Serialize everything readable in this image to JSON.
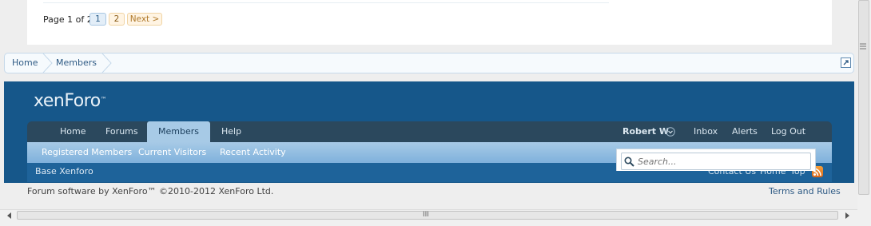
{
  "pagination": {
    "label": "Page 1 of 2",
    "pages": [
      "1",
      "2"
    ],
    "next": "Next >"
  },
  "breadcrumb": {
    "items": [
      "Home",
      "Members"
    ]
  },
  "footer": {
    "logo": "xenForo",
    "logo_mark": "™",
    "nav": {
      "tabs": [
        "Home",
        "Forums",
        "Members",
        "Help"
      ],
      "selected_tab": "Members",
      "user": "Robert W",
      "right_links": [
        "Inbox",
        "Alerts",
        "Log Out"
      ]
    },
    "subnav": [
      "Registered Members",
      "Current Visitors",
      "Recent Activity"
    ],
    "search": {
      "placeholder": "Search..."
    },
    "strip": {
      "left": "Base Xenforo",
      "links": [
        "Contact Us",
        "Home",
        "Top"
      ]
    },
    "copyright": "Forum software by XenForo™ ©2010-2012 XenForo Ltd.",
    "terms": "Terms and Rules"
  },
  "scrollbar": {
    "grip": "III"
  },
  "colors": {
    "band": "#16578a",
    "nav": "#2b485d",
    "subnav": "#7fb1dc",
    "link": "#2f5b85",
    "rss": "#e8841f"
  },
  "icons": [
    "external-link-icon",
    "chevron-down-icon",
    "search-icon",
    "rss-icon",
    "arrow-left-icon",
    "arrow-right-icon"
  ]
}
